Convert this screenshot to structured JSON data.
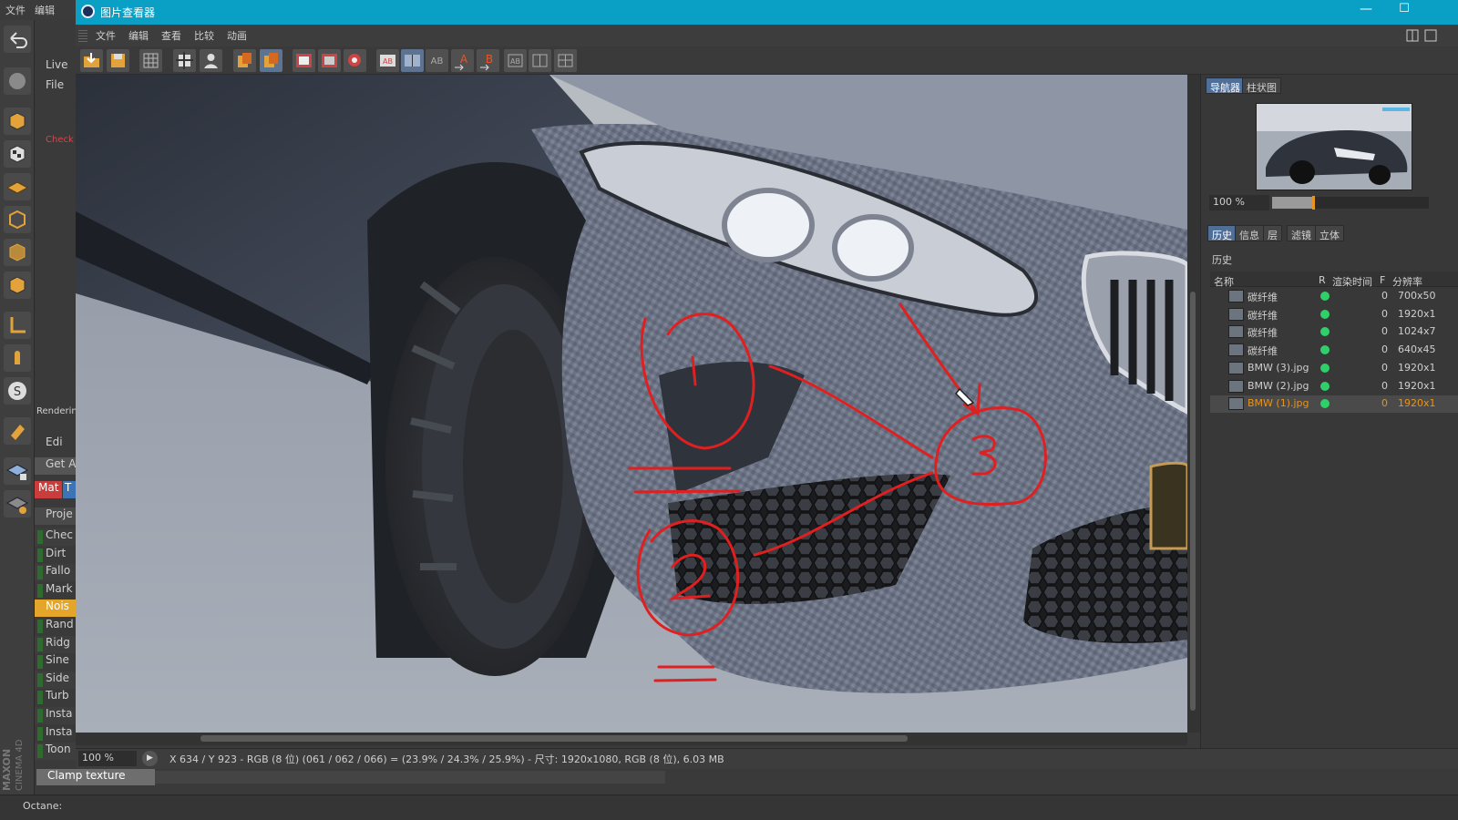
{
  "c4d": {
    "menu": [
      "文件",
      "编辑"
    ],
    "mid_labels": [
      "Live",
      "File",
      "Check",
      "Renderin",
      "Edi",
      "Get A",
      "Mat",
      "T",
      "Proje"
    ],
    "shader_list": [
      "Chec",
      "Dirt",
      "Fallo",
      "Mark",
      "Nois",
      "Rand",
      "Ridg",
      "Sine",
      "Side",
      "Turb",
      "Insta",
      "Insta",
      "Toon"
    ],
    "highlighted_shader": "Nois",
    "clamp_row": "Clamp texture",
    "status_left": "Octane:",
    "logo_text": [
      "MAXON",
      "CINEMA 4D"
    ]
  },
  "viewer": {
    "title": "图片查看器",
    "menu": [
      "文件",
      "编辑",
      "查看",
      "比较",
      "动画"
    ],
    "toolbar_icons": [
      "open-icon",
      "save-icon",
      "grid-icon",
      "render-region-icon",
      "person-icon",
      "layer-a-icon",
      "layer-b-icon",
      "fit-icon",
      "fit-screen-icon",
      "compare-icon",
      "ab-left-icon",
      "ab-split-icon",
      "ab-icon",
      "set-a-icon",
      "set-b-icon",
      "swap-icon",
      "channels-icon",
      "lut-icon"
    ],
    "zoom": "100 %",
    "status": "X 634 / Y 923 - RGB (8 位) (061 / 062 / 066) = (23.9% / 24.3% / 25.9%) - 尺寸: 1920x1080, RGB (8 位), 6.03 MB"
  },
  "navigator": {
    "tabs": [
      "导航器",
      "柱状图"
    ],
    "active_tab": "导航器",
    "zoom": "100 %",
    "zoom_level_fraction": 0.27
  },
  "history": {
    "tabs": [
      "历史",
      "信息",
      "层",
      "滤镜",
      "立体"
    ],
    "active_tab": "历史",
    "section_label": "历史",
    "columns": [
      "名称",
      "R",
      "渲染时间",
      "F",
      "分辨率"
    ],
    "rows": [
      {
        "name": "碳纤维",
        "time": "0",
        "res": "700x50"
      },
      {
        "name": "碳纤维",
        "time": "0",
        "res": "1920x1"
      },
      {
        "name": "碳纤维",
        "time": "0",
        "res": "1024x7"
      },
      {
        "name": "碳纤维",
        "time": "0",
        "res": "640x45"
      },
      {
        "name": "BMW (3).jpg",
        "time": "0",
        "res": "1920x1"
      },
      {
        "name": "BMW (2).jpg",
        "time": "0",
        "res": "1920x1"
      },
      {
        "name": "BMW (1).jpg",
        "time": "0",
        "res": "1920x1"
      }
    ],
    "selected_index": 6
  },
  "annotations": {
    "labels": [
      "1",
      "2",
      "3"
    ],
    "ink_color": "#e02020"
  },
  "colors": {
    "titlebar": "#0aa0c6",
    "accent_tab": "#4f6f99",
    "selection": "#e8941c",
    "status_dot": "#2fcf6a"
  }
}
